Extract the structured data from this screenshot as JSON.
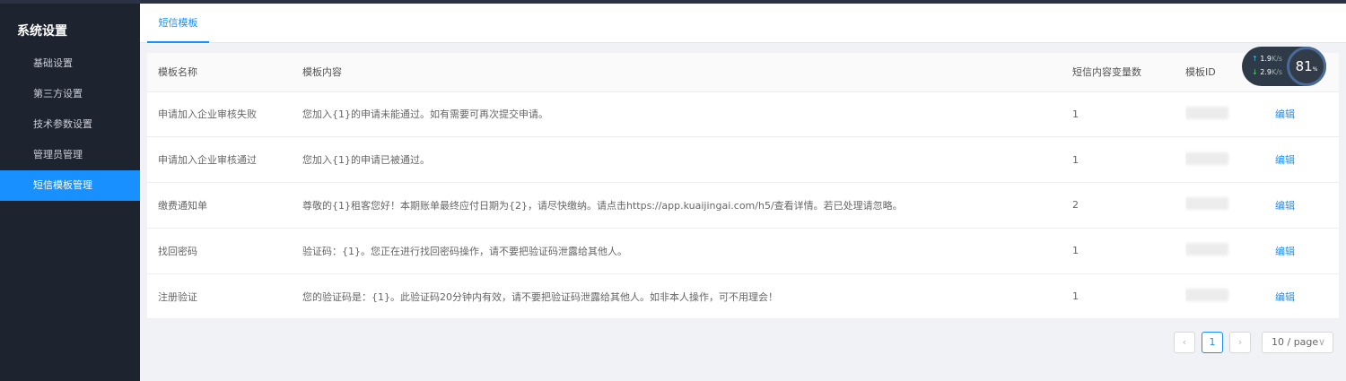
{
  "sidebar": {
    "title": "系统设置",
    "items": [
      {
        "label": "基础设置"
      },
      {
        "label": "第三方设置"
      },
      {
        "label": "技术参数设置"
      },
      {
        "label": "管理员管理"
      },
      {
        "label": "短信模板管理"
      }
    ],
    "active_index": 4
  },
  "tabs": [
    {
      "label": "短信模板"
    }
  ],
  "table": {
    "columns": [
      "模板名称",
      "模板内容",
      "短信内容变量数",
      "模板ID",
      ""
    ],
    "rows": [
      {
        "name": "申请加入企业审核失败",
        "content": "您加入{1}的申请未能通过。如有需要可再次提交申请。",
        "var_count": "1",
        "action": "编辑"
      },
      {
        "name": "申请加入企业审核通过",
        "content": "您加入{1}的申请已被通过。",
        "var_count": "1",
        "action": "编辑"
      },
      {
        "name": "缴费通知单",
        "content": "尊敬的{1}租客您好！本期账单最终应付日期为{2}，请尽快缴纳。请点击https://app.kuaijingai.com/h5/查看详情。若已处理请忽略。",
        "var_count": "2",
        "action": "编辑"
      },
      {
        "name": "找回密码",
        "content": "验证码：{1}。您正在进行找回密码操作，请不要把验证码泄露给其他人。",
        "var_count": "1",
        "action": "编辑"
      },
      {
        "name": "注册验证",
        "content": "您的验证码是：{1}。此验证码20分钟内有效，请不要把验证码泄露给其他人。如非本人操作，可不用理会！",
        "var_count": "1",
        "action": "编辑"
      }
    ]
  },
  "pagination": {
    "current_page": "1",
    "page_size": "10 / page",
    "prev_icon": "chevron-left-icon",
    "next_icon": "chevron-right-icon"
  },
  "speed_widget": {
    "upload": "1.9",
    "download": "2.9",
    "unit": "K/s",
    "percent": "81",
    "percent_suffix": "%"
  },
  "colors": {
    "accent": "#1890ff",
    "sidebar_bg": "#1e2330",
    "page_bg": "#f0f2f5"
  }
}
